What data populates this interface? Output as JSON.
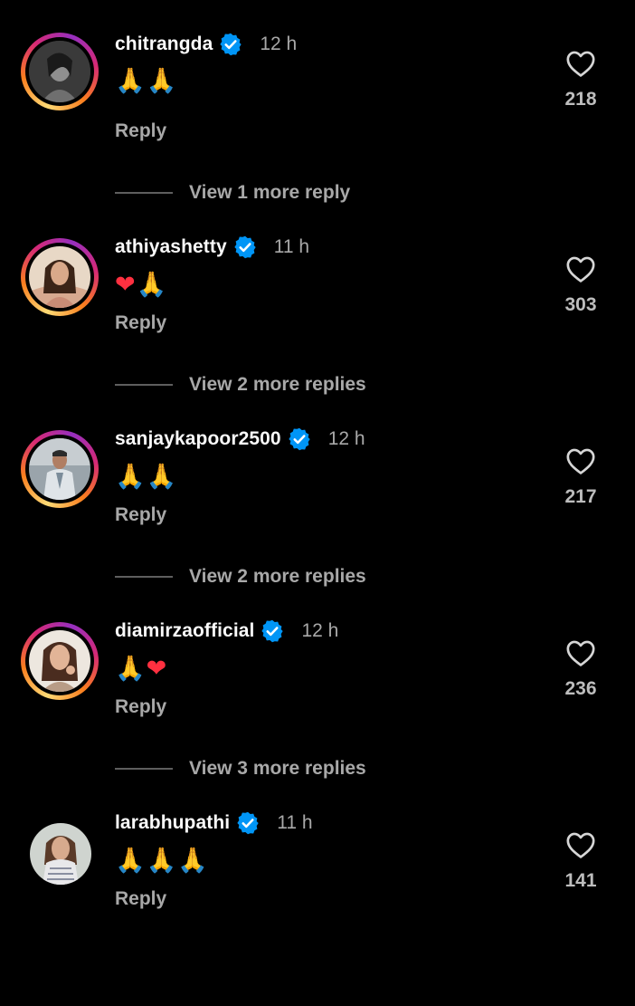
{
  "comments": [
    {
      "username": "chitrangda",
      "time": "12 h",
      "emojis": [
        {
          "char": "🙏",
          "tone": "pray"
        },
        {
          "char": "🙏",
          "tone": "pray"
        }
      ],
      "reply_label": "Reply",
      "likes": "218",
      "view_more": "View 1 more reply",
      "story_ring": true
    },
    {
      "username": "athiyashetty",
      "time": "11 h",
      "emojis": [
        {
          "char": "❤",
          "tone": "heart"
        },
        {
          "char": "🙏",
          "tone": "pray-dark"
        }
      ],
      "reply_label": "Reply",
      "likes": "303",
      "view_more": "View 2 more replies",
      "story_ring": true
    },
    {
      "username": "sanjaykapoor2500",
      "time": "12 h",
      "emojis": [
        {
          "char": "🙏",
          "tone": "pray"
        },
        {
          "char": "🙏",
          "tone": "pray"
        }
      ],
      "reply_label": "Reply",
      "likes": "217",
      "view_more": "View 2 more replies",
      "story_ring": true
    },
    {
      "username": "diamirzaofficial",
      "time": "12 h",
      "emojis": [
        {
          "char": "🙏",
          "tone": "pray-light"
        },
        {
          "char": "❤",
          "tone": "heart"
        }
      ],
      "reply_label": "Reply",
      "likes": "236",
      "view_more": "View 3 more replies",
      "story_ring": true
    },
    {
      "username": "larabhupathi",
      "time": "11 h",
      "emojis": [
        {
          "char": "🙏",
          "tone": "pray"
        },
        {
          "char": "🙏",
          "tone": "pray"
        },
        {
          "char": "🙏",
          "tone": "pray"
        }
      ],
      "reply_label": "Reply",
      "likes": "141",
      "view_more": "",
      "story_ring": false
    }
  ],
  "colors": {
    "background": "#000000",
    "username": "#fafafa",
    "secondary_text": "#a8a8a8",
    "verified_badge": "#0095f6",
    "heart_emoji": "#ff3040",
    "pray_emoji": "#f6b93b"
  },
  "icons": {
    "verified": "verified-badge-icon",
    "like": "heart-outline-icon"
  }
}
